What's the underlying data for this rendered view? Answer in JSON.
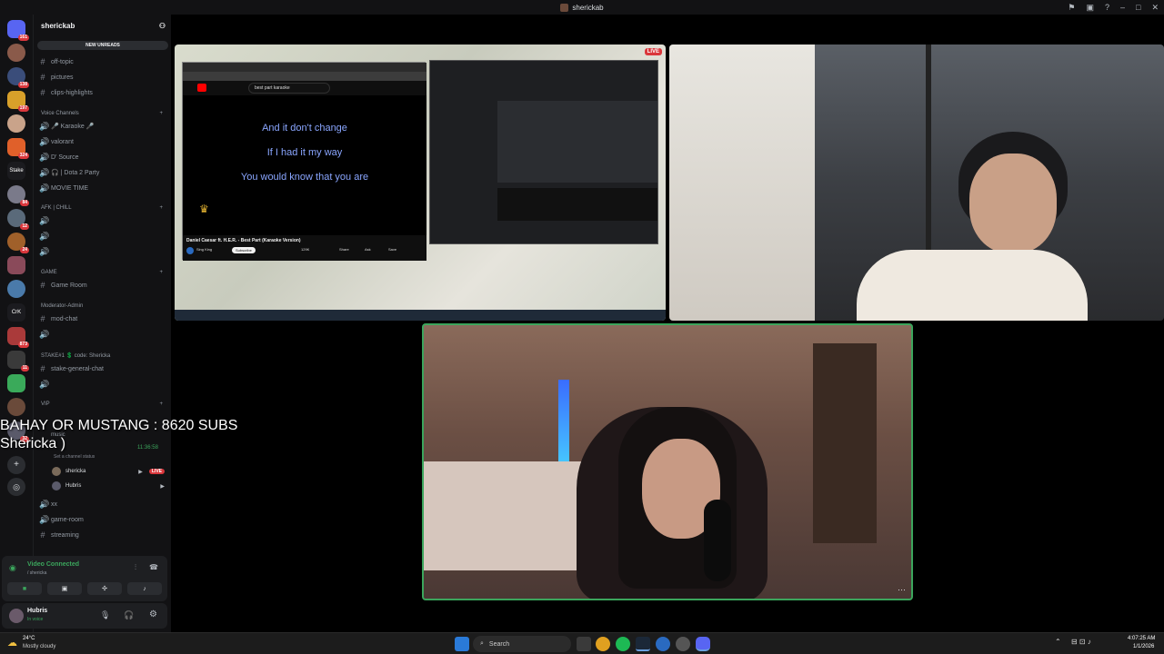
{
  "window": {
    "title": "sherickab"
  },
  "server": {
    "name": "sherickab",
    "new_unreads": "NEW UNREADS",
    "rail_badges": [
      "161",
      "138",
      "197",
      "324",
      "84",
      "12",
      "24",
      "873",
      "11",
      "32"
    ],
    "rail_labels": [
      "Stake",
      "CrK"
    ]
  },
  "channels": {
    "top": [
      "off-topic",
      "pictures",
      "clips-highlights"
    ],
    "voice_category": "Voice Channels",
    "voice": [
      "🎤 Karaoke 🎤",
      "valorant",
      "D' Source",
      "🎧 | Dota 2 Party",
      "MOVIE TIME"
    ],
    "afk_category": "AFK | CHILL",
    "game_category": "GAME",
    "game_room": "Game Room",
    "mod_category": "Moderator-Admin",
    "mod_chat": "mod-chat",
    "stake_category": "STAKE#1 💲 code: Shericka",
    "stake_chat": "stake-general-chat",
    "vip_category": "VIP",
    "music": "music",
    "timestamp": "11:36:58",
    "channel_status": "Set a channel status",
    "users": [
      {
        "name": "shericka",
        "live": "LIVE"
      },
      {
        "name": "Hubris"
      }
    ],
    "bottom": [
      "xx",
      "game-room",
      "streaming"
    ]
  },
  "voice_panel": {
    "status": "Video Connected",
    "location": "/ shericka"
  },
  "user_panel": {
    "username": "Hubris",
    "status": "In voice"
  },
  "overlay": {
    "line1": "BAHAY OR MUSTANG : 8620 SUBS",
    "line2": "Shericka )"
  },
  "screen_share": {
    "live_label": "LIVE",
    "lyrics": [
      "And it don't change",
      "If I had it my way",
      "You would know that you are"
    ],
    "video_title": "Daniel Caesar ft. H.E.R. - Best Part (Karaoke Version)",
    "channel": "Sing King",
    "subscribe": "Subscribe",
    "search_query": "best part karaoke",
    "likes": "129K",
    "share": "Share",
    "ask": "Ask",
    "save": "Save"
  },
  "taskbar": {
    "weather_temp": "24°C",
    "weather_desc": "Mostly cloudy",
    "search": "Search",
    "time": "4:07:25 AM",
    "date": "1/1/2026"
  },
  "colors": {
    "accent_green": "#3ba55c",
    "live_red": "#da373c",
    "sidebar_bg": "#121214"
  }
}
